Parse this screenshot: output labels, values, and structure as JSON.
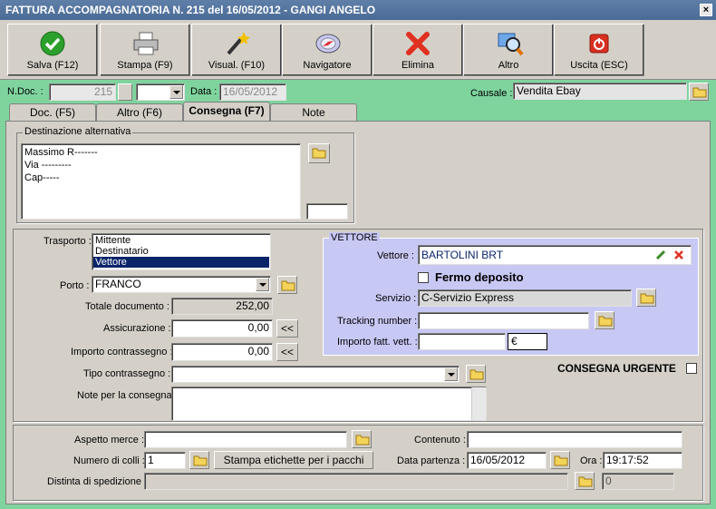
{
  "window": {
    "title": "FATTURA ACCOMPAGNATORIA N. 215  del 16/05/2012 - GANGI ANGELO",
    "close": "×"
  },
  "toolbar": [
    {
      "label": "Salva (F12)",
      "icon": "check-icon"
    },
    {
      "label": "Stampa (F9)",
      "icon": "printer-icon"
    },
    {
      "label": "Visual. (F10)",
      "icon": "wand-icon"
    },
    {
      "label": "Navigatore",
      "icon": "compass-icon"
    },
    {
      "label": "Elimina",
      "icon": "delete-icon"
    },
    {
      "label": "Altro",
      "icon": "magnifier-icon"
    },
    {
      "label": "Uscita (ESC)",
      "icon": "power-icon"
    }
  ],
  "header": {
    "ndoc_label": "N.Doc. :",
    "ndoc_value": "215",
    "data_label": "Data :",
    "data_value": "16/05/2012",
    "causale_label": "Causale :",
    "causale_value": "Vendita Ebay"
  },
  "tabs": [
    "Doc. (F5)",
    "Altro (F6)",
    "Consegna (F7)",
    "Note"
  ],
  "dest": {
    "title": "Destinazione alternativa",
    "lines": [
      "Massimo R-------",
      "Via ---------",
      "Cap-----"
    ]
  },
  "trasporto": {
    "label": "Trasporto :",
    "options": [
      "Mittente",
      "Destinatario",
      "Vettore"
    ],
    "selected": "Vettore"
  },
  "porto": {
    "label": "Porto :",
    "value": "FRANCO"
  },
  "totale": {
    "label": "Totale documento :",
    "value": "252,00"
  },
  "assicurazione": {
    "label": "Assicurazione :",
    "value": "0,00",
    "btn": "<<"
  },
  "contrassegno": {
    "label": "Importo contrassegno :",
    "value": "0,00",
    "btn": "<<"
  },
  "tipo_contrassegno": {
    "label": "Tipo contrassegno :",
    "value": ""
  },
  "note_consegna": {
    "label": "Note per la consegna",
    "value": ""
  },
  "vettore": {
    "title": "VETTORE",
    "vettore_label": "Vettore :",
    "vettore_value": "BARTOLINI BRT",
    "fermo_label": "Fermo deposito",
    "servizio_label": "Servizio :",
    "servizio_value": "C-Servizio Express",
    "tracking_label": "Tracking number :",
    "tracking_value": "",
    "importo_label": "Importo fatt. vett. :",
    "importo_value": "",
    "currency": "€"
  },
  "urgente": {
    "label": "CONSEGNA URGENTE"
  },
  "bottom": {
    "aspetto_label": "Aspetto merce :",
    "aspetto_value": "",
    "contenuto_label": "Contenuto :",
    "contenuto_value": "",
    "colli_label": "Numero di colli :",
    "colli_value": "1",
    "stampa_btn": "Stampa etichette per i pacchi",
    "partenza_label": "Data partenza :",
    "partenza_value": "16/05/2012",
    "ora_label": "Ora :",
    "ora_value": "19:17:52",
    "distinta_label": "Distinta di spedizione :",
    "distinta_value": "",
    "distinta_num": "0"
  }
}
